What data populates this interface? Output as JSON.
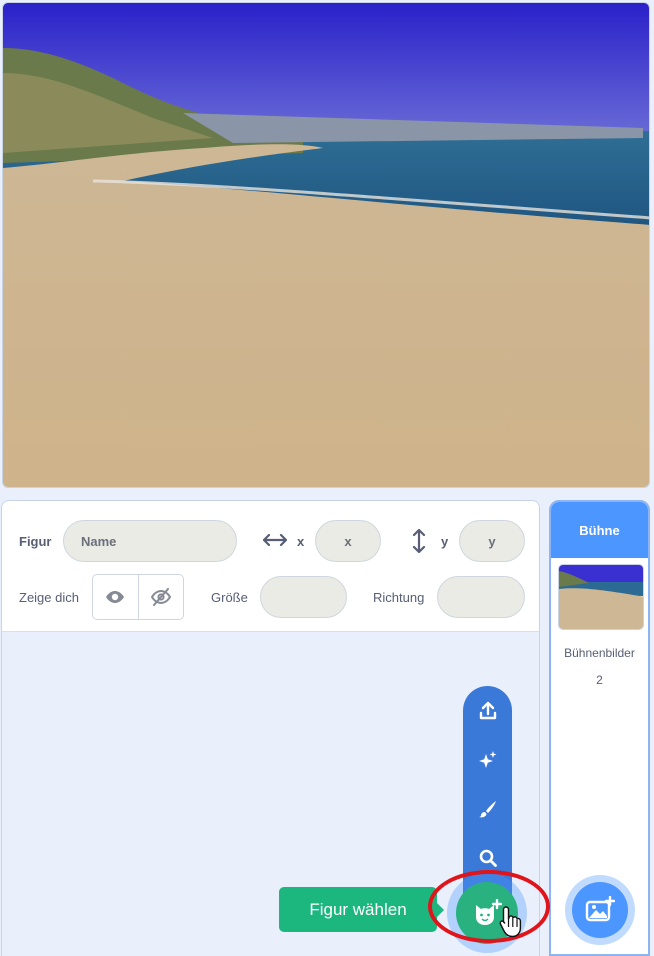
{
  "stage": {
    "backdrop": "beach"
  },
  "sprite_info": {
    "sprite_label": "Figur",
    "name_placeholder": "Name",
    "x_label": "x",
    "x_placeholder": "x",
    "y_label": "y",
    "y_placeholder": "y",
    "show_label": "Zeige dich",
    "size_label": "Größe",
    "direction_label": "Richtung"
  },
  "stage_panel": {
    "header": "Bühne",
    "backdrops_label": "Bühnenbilder",
    "backdrops_count": "2"
  },
  "sprite_menu": {
    "items": [
      "upload-icon",
      "surprise-icon",
      "paint-icon",
      "search-icon"
    ],
    "tooltip": "Figur wählen"
  },
  "colors": {
    "accent": "#4c97ff",
    "menu": "#3a79d8",
    "choose_green": "#29b27f",
    "highlight": "#e0141b"
  }
}
